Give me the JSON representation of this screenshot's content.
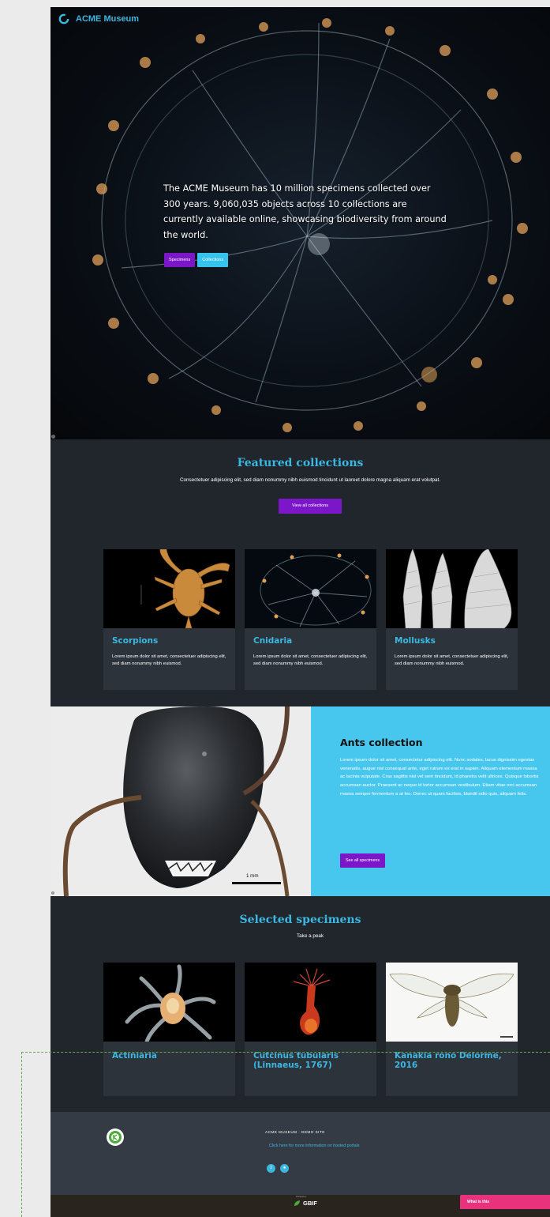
{
  "brand": {
    "name": "ACME Museum",
    "logo_icon": "acme-logo-icon",
    "accent": "#3bb8e2"
  },
  "hero": {
    "text": "The ACME Museum has 10 million specimens collected over 300 years. 9,060,035 objects across 10 collections are currently available online, showcasing biodiversity from around the world.",
    "buttons": {
      "specimens": "Specimens",
      "collections": "Collections"
    }
  },
  "featured": {
    "title": "Featured collections",
    "description": "Consectetuer adipiscing elit, sed diam nonummy nibh euismod tincidunt ut laoreet dolore magna aliquam erat volutpat.",
    "view_all": "View all collections",
    "cards": [
      {
        "title": "Scorpions",
        "text": "Lorem ipsum dolor sit amet, consectetuer adipiscing elit, sed diam nonummy nibh euismod."
      },
      {
        "title": "Cnidaria",
        "text": "Lorem ipsum dolor sit amet, consectetuer adipiscing elit, sed diam nonummy nibh euismod."
      },
      {
        "title": "Mollusks",
        "text": "Lorem ipsum dolor sit amet, consectetuer adipiscing elit, sed diam nonummy nibh euismod."
      }
    ]
  },
  "ants": {
    "title": "Ants collection",
    "text": "Lorem ipsum dolor sit amet, consectetur adipiscing elit. Nunc sodales, lacus dignissim egestas venenatis, augue nisl consequat ante, eget rutrum ex erat in sapien. Aliquam elementum massa ac lacinia vulputate. Cras sagittis nisl vel sem tincidunt, id pharetra velit ultrices. Quisque lobortis accumsan auctor. Praesent ac neque id tortor accumsan vestibulum. Etiam vitae orci accumsan massa semper fermentum a at leo. Donec ut quam facilisis, blandit odio quis, aliquam felis.",
    "button": "See all specimens",
    "scale_label": "1 mm"
  },
  "selected": {
    "title": "Selected specimens",
    "subtitle": "Take a peak",
    "cards": [
      {
        "title": "Actiniaria"
      },
      {
        "title": "Cutcinus tubularis (Linnaeus, 1767)"
      },
      {
        "title": "Kanakia rono Delorme, 2016"
      }
    ]
  },
  "footer": {
    "title": "ACME MUSEUM - DEMO SITE",
    "link": "Click here for more information on hosted portals",
    "social": [
      "twitter-icon",
      "github-icon"
    ],
    "powered_by": "Powered by",
    "gbif": "GBIF",
    "help_button": "What is this"
  },
  "colors": {
    "purple": "#7b17c8",
    "cyan": "#36c3ec",
    "dark": "#21262d",
    "card": "#2d333b",
    "pink": "#e8337c",
    "ants_panel": "#48c7ee"
  }
}
